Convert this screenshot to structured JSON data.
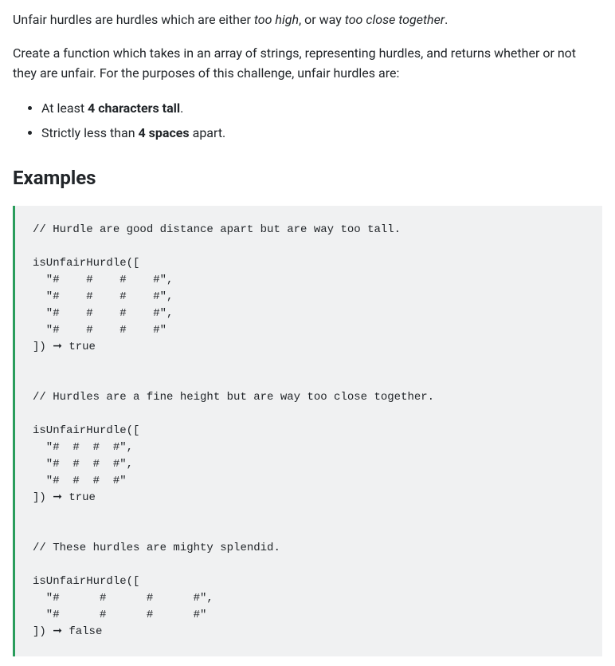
{
  "intro": {
    "prefix": "Unfair hurdles are hurdles which are either ",
    "em1": "too high",
    "mid": ", or way ",
    "em2": "too close together",
    "suffix": "."
  },
  "description": "Create a function which takes in an array of strings, representing hurdles, and returns whether or not they are unfair. For the purposes of this challenge, unfair hurdles are:",
  "rules": {
    "r1_pre": "At least ",
    "r1_bold": "4 characters tall",
    "r1_post": ".",
    "r2_pre": "Strictly less than ",
    "r2_bold": "4 spaces",
    "r2_post": " apart."
  },
  "examples_heading": "Examples",
  "code": "// Hurdle are good distance apart but are way too tall.\n\nisUnfairHurdle([\n  \"#    #    #    #\",\n  \"#    #    #    #\",\n  \"#    #    #    #\",\n  \"#    #    #    #\"\n]) ➞ true\n\n\n// Hurdles are a fine height but are way too close together.\n\nisUnfairHurdle([\n  \"#  #  #  #\",\n  \"#  #  #  #\",\n  \"#  #  #  #\"\n]) ➞ true\n\n\n// These hurdles are mighty splendid.\n\nisUnfairHurdle([\n  \"#      #      #      #\",\n  \"#      #      #      #\"\n]) ➞ false"
}
